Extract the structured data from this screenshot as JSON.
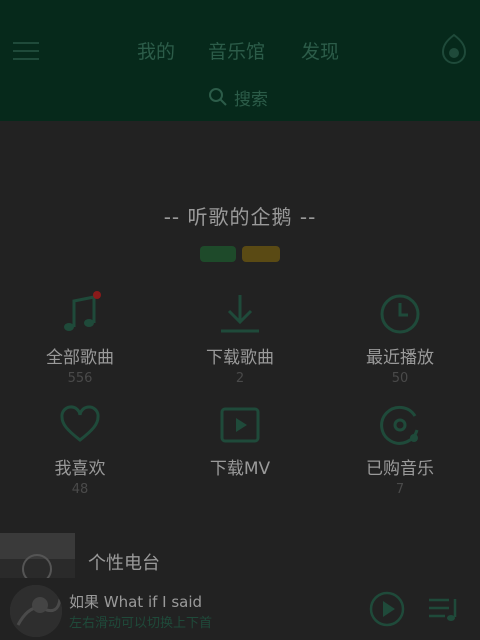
{
  "header": {
    "tabs": [
      "我的",
      "音乐馆",
      "发现"
    ],
    "search_label": "搜索"
  },
  "slogan": "-- 听歌的企鹅 --",
  "grid": [
    {
      "label": "全部歌曲",
      "count": "556",
      "icon": "music-note-icon"
    },
    {
      "label": "下载歌曲",
      "count": "2",
      "icon": "download-icon"
    },
    {
      "label": "最近播放",
      "count": "50",
      "icon": "clock-icon"
    },
    {
      "label": "我喜欢",
      "count": "48",
      "icon": "heart-icon"
    },
    {
      "label": "下载MV",
      "count": "",
      "icon": "play-box-icon"
    },
    {
      "label": "已购音乐",
      "count": "7",
      "icon": "disc-icon"
    }
  ],
  "radio": {
    "title": "个性电台"
  },
  "player": {
    "title": "如果 What if I said",
    "subtitle": "左右滑动可以切换上下首"
  },
  "colors": {
    "header_bg": "#06291b",
    "accent": "#1f4a3a",
    "page_bg": "#222222",
    "notification_dot": "#8a1a1a"
  }
}
